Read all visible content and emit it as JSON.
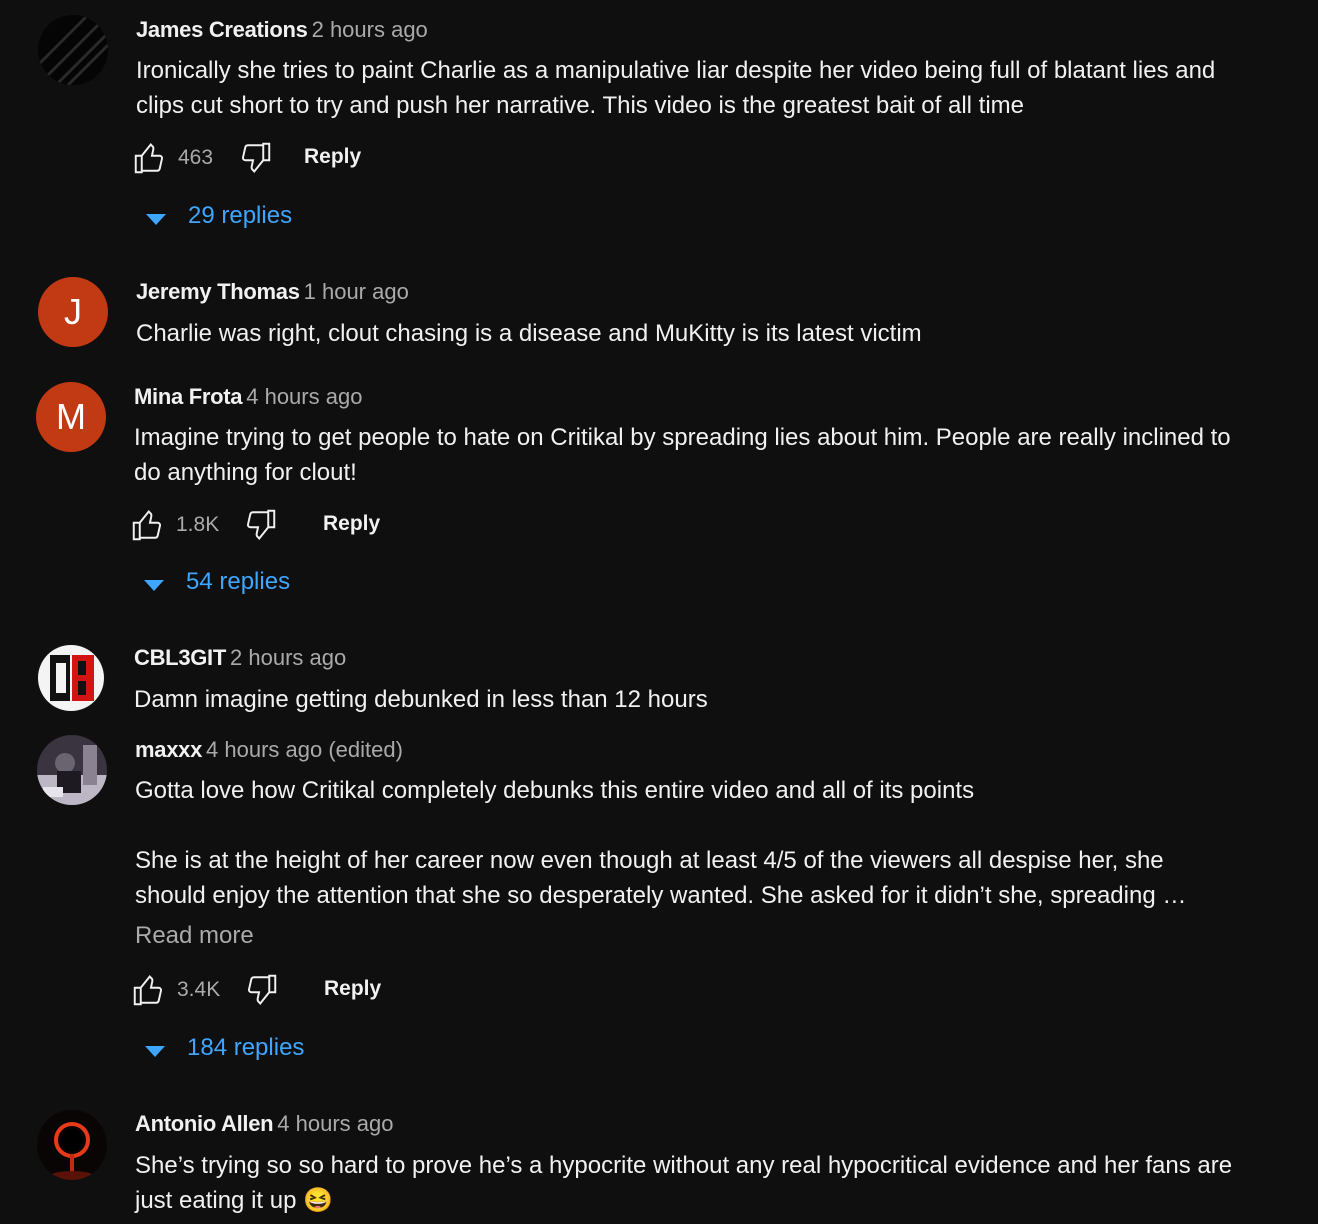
{
  "comments": [
    {
      "author": "James Creations",
      "time": "2 hours ago",
      "text": "Ironically she tries to paint Charlie as a manipulative liar despite her video being full of blatant lies and clips cut short to try and push her narrative. This video is the greatest bait of all time",
      "likes": "463",
      "reply": "Reply",
      "replies": "29 replies"
    },
    {
      "author": "Jeremy Thomas",
      "time": "1 hour ago",
      "avatar_letter": "J",
      "text": "Charlie was right, clout chasing is a disease and MuKitty is its latest victim"
    },
    {
      "author": "Mina Frota",
      "time": "4 hours ago",
      "avatar_letter": "M",
      "text": "Imagine trying to get people to hate on Critikal by spreading lies about him. People are really inclined to do anything for clout!",
      "likes": "1.8K",
      "reply": "Reply",
      "replies": "54 replies"
    },
    {
      "author": "CBL3GIT",
      "time": "2 hours ago",
      "avatar_logo": "CB",
      "text": "Damn imagine getting debunked in less than 12 hours"
    },
    {
      "author": "maxxx",
      "time": "4 hours ago (edited)",
      "text_1": "Gotta love how Critikal completely debunks this entire video and all of its points",
      "text_2": "She is at the height of her career now even though at least 4/5 of the viewers all despise her, she should enjoy the attention that she so desperately wanted. She asked for it didn’t she, spreading …",
      "read_more": "Read more",
      "likes": "3.4K",
      "reply": "Reply",
      "replies": "184 replies"
    },
    {
      "author": "Antonio Allen",
      "time": "4 hours ago",
      "text": "She’s trying so so hard to prove he’s a hypocrite without any real hypocritical evidence and her fans are just eating it up 😆"
    }
  ],
  "colors": {
    "background": "#0f0f0f",
    "link": "#3ea6ff",
    "secondary_text": "#aaaaaa",
    "avatar_letter_bg": "#c23a13"
  },
  "icons": [
    "thumbs-up-icon",
    "thumbs-down-icon",
    "expand-triangle-icon"
  ]
}
